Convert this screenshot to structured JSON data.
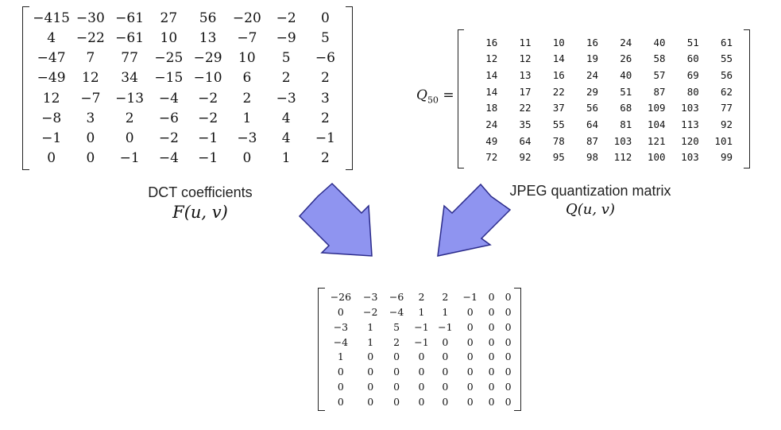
{
  "dct": {
    "caption": "DCT coefficients",
    "formula": "F(u, v)",
    "rows": [
      [
        "−415",
        "−30",
        "−61",
        "27",
        "56",
        "−20",
        "−2",
        "0"
      ],
      [
        "4",
        "−22",
        "−61",
        "10",
        "13",
        "−7",
        "−9",
        "5"
      ],
      [
        "−47",
        "7",
        "77",
        "−25",
        "−29",
        "10",
        "5",
        "−6"
      ],
      [
        "−49",
        "12",
        "34",
        "−15",
        "−10",
        "6",
        "2",
        "2"
      ],
      [
        "12",
        "−7",
        "−13",
        "−4",
        "−2",
        "2",
        "−3",
        "3"
      ],
      [
        "−8",
        "3",
        "2",
        "−6",
        "−2",
        "1",
        "4",
        "2"
      ],
      [
        "−1",
        "0",
        "0",
        "−2",
        "−1",
        "−3",
        "4",
        "−1"
      ],
      [
        "0",
        "0",
        "−1",
        "−4",
        "−1",
        "0",
        "1",
        "2"
      ]
    ]
  },
  "quant": {
    "symbol": "Q",
    "subscript": "50",
    "equals": "=",
    "caption": "JPEG quantization matrix",
    "formula": "Q(u, v)",
    "rows": [
      [
        "16",
        "11",
        "10",
        "16",
        "24",
        "40",
        "51",
        "61"
      ],
      [
        "12",
        "12",
        "14",
        "19",
        "26",
        "58",
        "60",
        "55"
      ],
      [
        "14",
        "13",
        "16",
        "24",
        "40",
        "57",
        "69",
        "56"
      ],
      [
        "14",
        "17",
        "22",
        "29",
        "51",
        "87",
        "80",
        "62"
      ],
      [
        "18",
        "22",
        "37",
        "56",
        "68",
        "109",
        "103",
        "77"
      ],
      [
        "24",
        "35",
        "55",
        "64",
        "81",
        "104",
        "113",
        "92"
      ],
      [
        "49",
        "64",
        "78",
        "87",
        "103",
        "121",
        "120",
        "101"
      ],
      [
        "72",
        "92",
        "95",
        "98",
        "112",
        "100",
        "103",
        "99"
      ]
    ]
  },
  "result": {
    "rows": [
      [
        "−26",
        "−3",
        "−6",
        "2",
        "2",
        "−1",
        "0",
        "0"
      ],
      [
        "0",
        "−2",
        "−4",
        "1",
        "1",
        "0",
        "0",
        "0"
      ],
      [
        "−3",
        "1",
        "5",
        "−1",
        "−1",
        "0",
        "0",
        "0"
      ],
      [
        "−4",
        "1",
        "2",
        "−1",
        "0",
        "0",
        "0",
        "0"
      ],
      [
        "1",
        "0",
        "0",
        "0",
        "0",
        "0",
        "0",
        "0"
      ],
      [
        "0",
        "0",
        "0",
        "0",
        "0",
        "0",
        "0",
        "0"
      ],
      [
        "0",
        "0",
        "0",
        "0",
        "0",
        "0",
        "0",
        "0"
      ],
      [
        "0",
        "0",
        "0",
        "0",
        "0",
        "0",
        "0",
        "0"
      ]
    ]
  },
  "colors": {
    "arrow_fill": "#8f94f0",
    "arrow_stroke": "#2a2a8a"
  }
}
